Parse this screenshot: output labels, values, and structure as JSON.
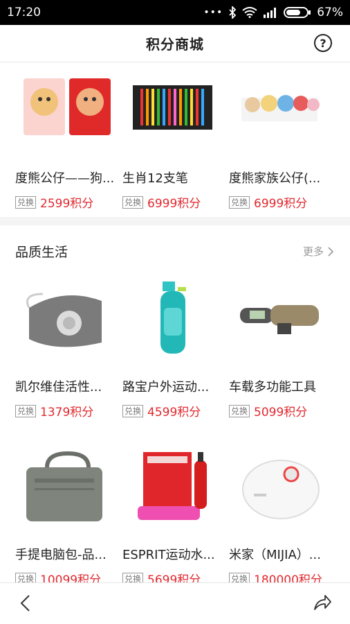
{
  "status": {
    "time": "17:20",
    "battery": "67%"
  },
  "header": {
    "title": "积分商城",
    "help_symbol": "?"
  },
  "top_row": [
    {
      "name": "度熊公仔——狗...",
      "badge": "兑换",
      "price": "2599积分",
      "icon": "bear-doll-bags"
    },
    {
      "name": "生肖12支笔",
      "badge": "兑换",
      "price": "6999积分",
      "icon": "pen-set"
    },
    {
      "name": "度熊家族公仔(...",
      "badge": "兑换",
      "price": "6999积分",
      "icon": "plush-family"
    }
  ],
  "section": {
    "title": "品质生活",
    "more": "更多"
  },
  "section_rows": [
    [
      {
        "name": "凯尔维佳活性...",
        "badge": "兑换",
        "price": "1379积分",
        "icon": "face-mask"
      },
      {
        "name": "路宝户外运动...",
        "badge": "兑换",
        "price": "4599积分",
        "icon": "water-bottle"
      },
      {
        "name": "车载多功能工具",
        "badge": "兑换",
        "price": "5099积分",
        "icon": "tire-gauge"
      }
    ],
    [
      {
        "name": "手提电脑包-品...",
        "badge": "兑换",
        "price": "10099积分",
        "icon": "laptop-bag"
      },
      {
        "name": "ESPRIT运动水...",
        "badge": "兑换",
        "price": "5699积分",
        "icon": "sport-kit"
      },
      {
        "name": "米家（MIJIA）...",
        "badge": "兑换",
        "price": "180000积分",
        "icon": "robot-vacuum"
      }
    ]
  ],
  "colors": {
    "price": "#e1292f",
    "statusbar": "#000000"
  }
}
